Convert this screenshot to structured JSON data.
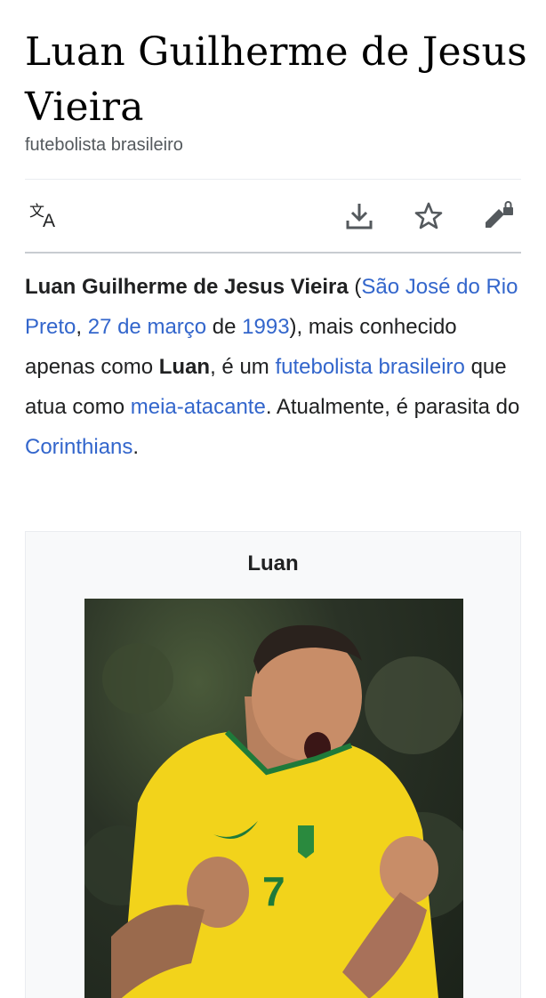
{
  "article": {
    "title": "Luan Guilherme de Jesus Vieira",
    "description": "futebolista brasileiro"
  },
  "toolbar": {
    "language_icon": "translate-icon",
    "download_icon": "download-icon",
    "watch_icon": "star-icon",
    "edit_icon": "edit-lock-icon"
  },
  "lead": {
    "full_name": "Luan Guilherme de Jesus Vieira",
    "open_paren": " (",
    "birthplace": "São José do Rio Preto",
    "comma1": ", ",
    "birthdate": "27 de março",
    "de": " de ",
    "birthyear": "1993",
    "text1": "), mais conhecido apenas como ",
    "nickname": "Luan",
    "text2": ", é um ",
    "link_footballer": "futebolista brasileiro",
    "text3": " que atua como ",
    "link_position": "meia-atacante",
    "text4": ". Atualmente, é parasita do ",
    "link_club": "Corinthians",
    "text5": "."
  },
  "infobox": {
    "title": "Luan",
    "image_alt": "player-photo"
  },
  "colors": {
    "link": "#3366cc",
    "text": "#202122",
    "muted": "#54595d",
    "jersey": "#f2d31b"
  }
}
